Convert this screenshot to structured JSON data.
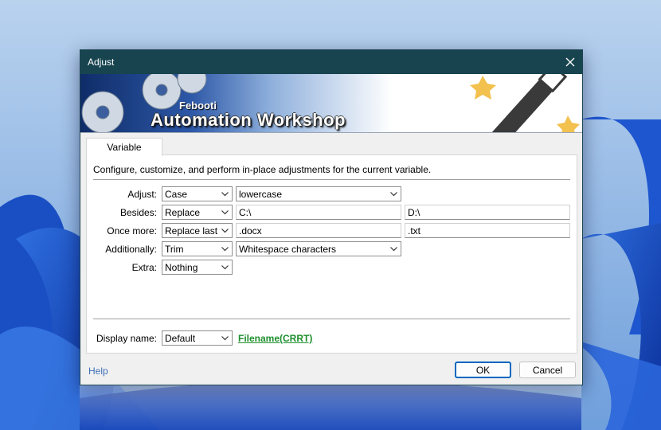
{
  "window": {
    "title": "Adjust"
  },
  "banner": {
    "brand_small": "Febooti",
    "brand_big": "Automation Workshop"
  },
  "tab": {
    "label": "Variable"
  },
  "description": "Configure, customize, and perform in-place adjustments for the current variable.",
  "rows": {
    "adjust": {
      "label": "Adjust:",
      "mode": "Case",
      "value": "lowercase"
    },
    "besides": {
      "label": "Besides:",
      "mode": "Replace",
      "find": "C:\\",
      "replace": "D:\\"
    },
    "once_more": {
      "label": "Once more:",
      "mode": "Replace last",
      "find": ".docx",
      "replace": ".txt"
    },
    "additionally": {
      "label": "Additionally:",
      "mode": "Trim",
      "value": "Whitespace characters"
    },
    "extra": {
      "label": "Extra:",
      "mode": "Nothing"
    }
  },
  "display_name": {
    "label": "Display name:",
    "mode": "Default",
    "preview": "Filename(CRRT)"
  },
  "footer": {
    "help": "Help",
    "ok": "OK",
    "cancel": "Cancel"
  },
  "colors": {
    "titlebar": "#17444f",
    "ok_border": "#0067c0",
    "preview_link": "#1e8f2d",
    "help_link": "#3c6fb7"
  }
}
